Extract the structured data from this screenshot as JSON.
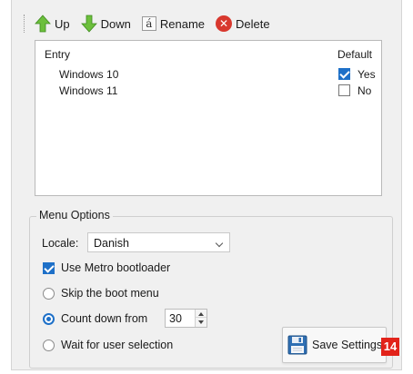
{
  "toolbar": {
    "up_label": "Up",
    "down_label": "Down",
    "rename_glyph": "á",
    "rename_label": "Rename",
    "delete_label": "Delete",
    "up_icon": "arrow-up-icon",
    "down_icon": "arrow-down-icon",
    "delete_icon": "delete-icon"
  },
  "list": {
    "columns": {
      "entry": "Entry",
      "default": "Default"
    },
    "rows": [
      {
        "name": "Windows 10",
        "default_checked": true,
        "default_text": "Yes"
      },
      {
        "name": "Windows 11",
        "default_checked": false,
        "default_text": "No"
      }
    ]
  },
  "menu_options": {
    "title": "Menu Options",
    "locale_label": "Locale:",
    "locale_value": "Danish",
    "use_metro_label": "Use Metro bootloader",
    "use_metro_checked": true,
    "skip_boot_label": "Skip the boot menu",
    "countdown_label": "Count down from",
    "countdown_value": "30",
    "wait_label": "Wait for user selection",
    "selected_mode": "countdown"
  },
  "save_button": {
    "label": "Save Settings"
  },
  "badge": {
    "text": "14"
  },
  "colors": {
    "accent": "#1e70c8",
    "up_arrow": "#6cbf3c",
    "delete": "#d8382e",
    "badge": "#e2231a"
  }
}
